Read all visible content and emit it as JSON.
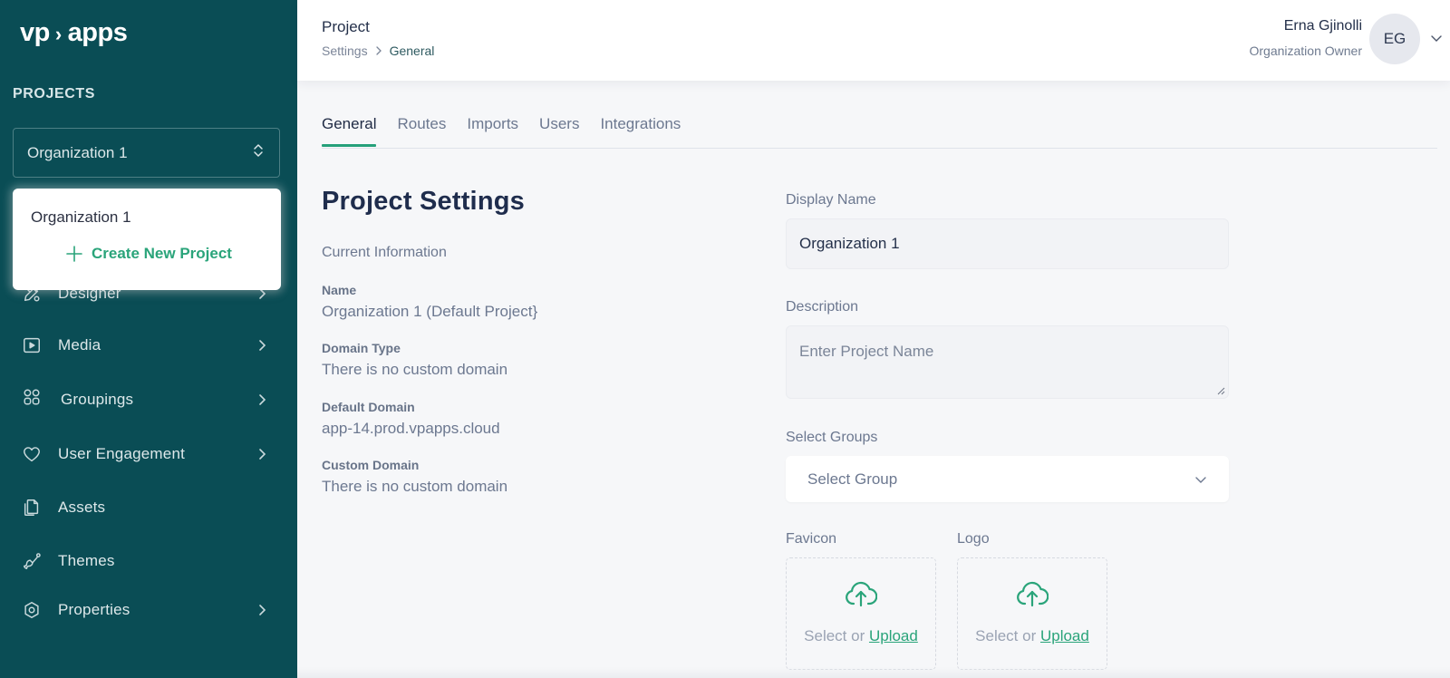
{
  "brand": {
    "logo_left": "vp",
    "logo_sep": "›",
    "logo_right": "apps",
    "accent": "#25a07a",
    "sidebar_bg": "#0a4d55"
  },
  "sidebar": {
    "section_label": "PROJECTS",
    "project_select": {
      "value": "Organization 1",
      "icon": "chevron-up-down-icon"
    },
    "dropdown": {
      "options": [
        "Organization 1"
      ],
      "create_label": "Create New Project",
      "create_icon": "plus-icon"
    },
    "items": [
      {
        "label": "Designer",
        "icon": "designer-icon",
        "has_submenu": true
      },
      {
        "label": "Media",
        "icon": "media-icon",
        "has_submenu": true
      },
      {
        "label": "Groupings",
        "icon": "groupings-icon",
        "has_submenu": true
      },
      {
        "label": "User Engagement",
        "icon": "heart-icon",
        "has_submenu": true
      },
      {
        "label": "Assets",
        "icon": "files-icon",
        "has_submenu": false
      },
      {
        "label": "Themes",
        "icon": "brush-icon",
        "has_submenu": false
      },
      {
        "label": "Properties",
        "icon": "hexagon-settings-icon",
        "has_submenu": true
      }
    ]
  },
  "header": {
    "title": "Project",
    "breadcrumb": [
      "Settings",
      "General"
    ],
    "user": {
      "name": "Erna Gjinolli",
      "role": "Organization Owner",
      "initials": "EG"
    }
  },
  "tabs": [
    {
      "label": "General",
      "active": true
    },
    {
      "label": "Routes",
      "active": false
    },
    {
      "label": "Imports",
      "active": false
    },
    {
      "label": "Users",
      "active": false
    },
    {
      "label": "Integrations",
      "active": false
    }
  ],
  "main": {
    "page_title": "Project Settings",
    "current_info_label": "Current Information",
    "info": [
      {
        "key": "Name",
        "value": "Organization 1 (Default Project}"
      },
      {
        "key": "Domain Type",
        "value": "There is no custom domain"
      },
      {
        "key": "Default Domain",
        "value": "app-14.prod.vpapps.cloud"
      },
      {
        "key": "Custom Domain",
        "value": "There is no custom domain"
      }
    ],
    "form": {
      "display_name": {
        "label": "Display Name",
        "value": "Organization 1"
      },
      "description": {
        "label": "Description",
        "value": "",
        "placeholder": "Enter Project Name"
      },
      "groups": {
        "label": "Select Groups",
        "placeholder": "Select Group"
      },
      "favicon": {
        "label": "Favicon",
        "prompt": "Select or ",
        "link": "Upload"
      },
      "logo": {
        "label": "Logo",
        "prompt": "Select or ",
        "link": "Upload"
      }
    }
  }
}
